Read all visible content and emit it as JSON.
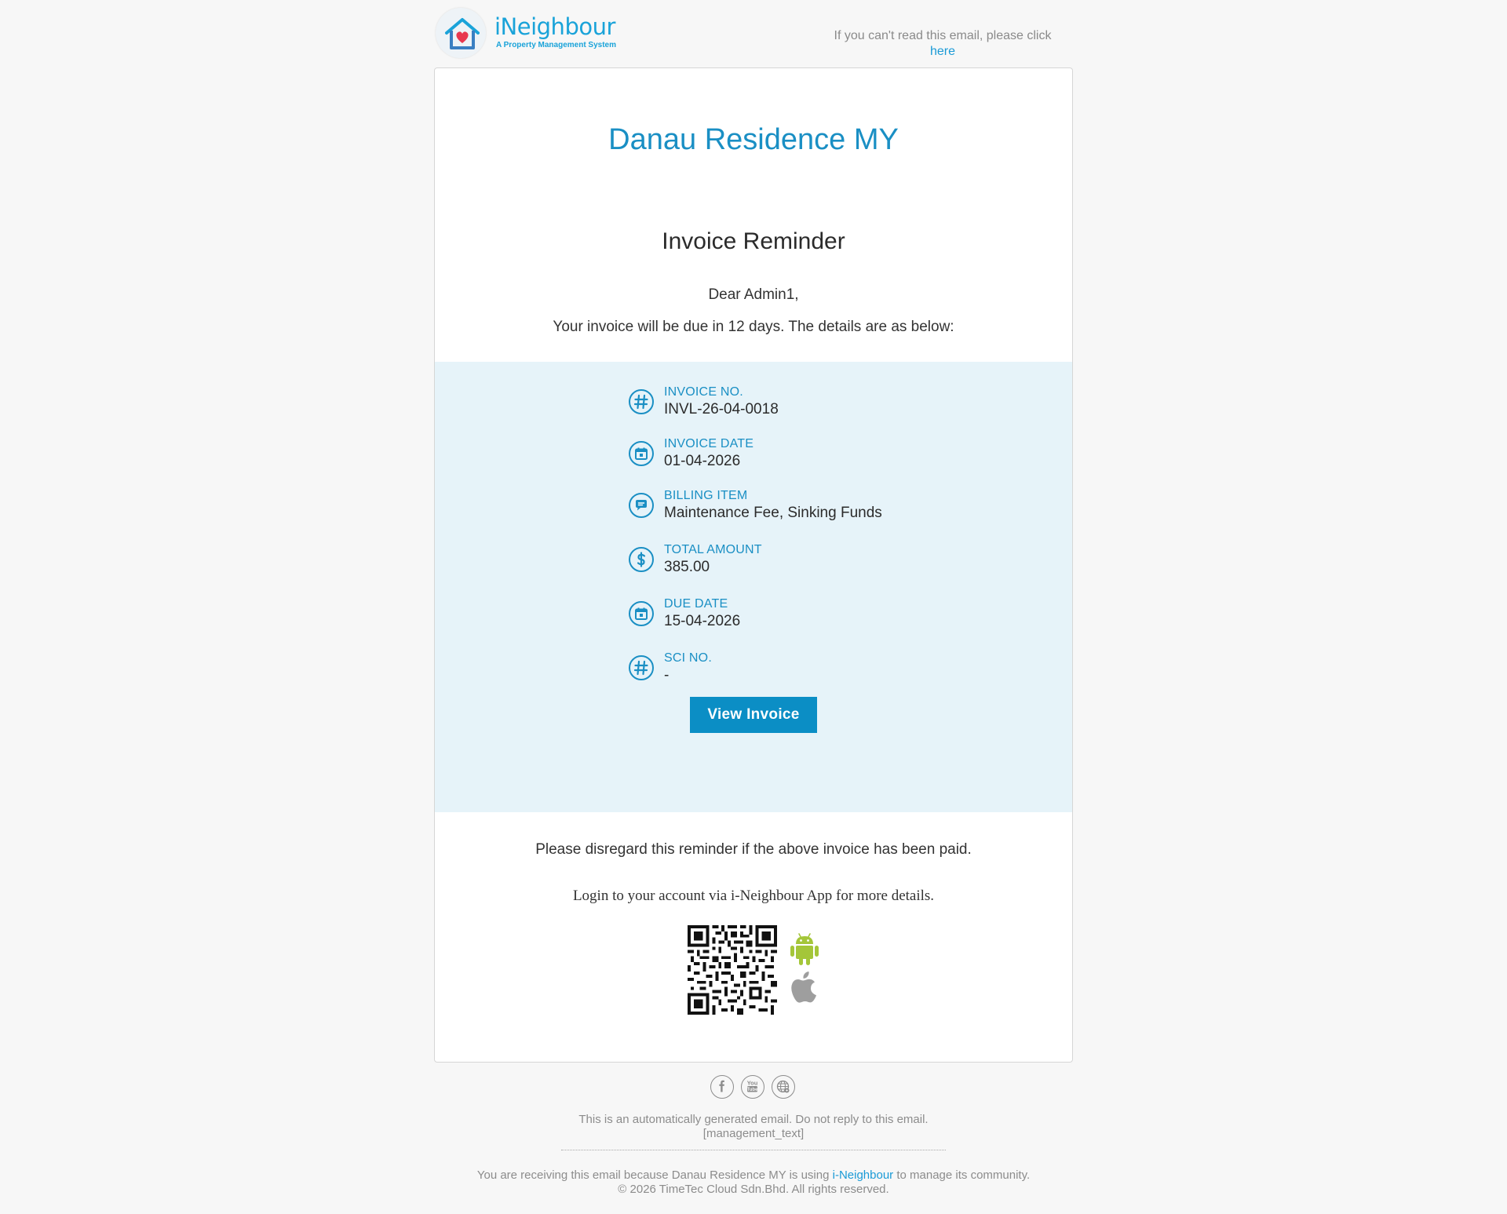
{
  "header": {
    "logo_name": "iNeighbour",
    "logo_tagline": "A Property Management System",
    "cant_read_text": "If you can't read this email, please click",
    "cant_read_link": "here"
  },
  "email": {
    "community_name": "Danau Residence MY",
    "title": "Invoice Reminder",
    "greeting": "Dear Admin1,",
    "intro": "Your invoice will be due in 12 days. The details are as below:",
    "details": [
      {
        "label": "INVOICE NO.",
        "value": "INVL-26-04-0018",
        "icon": "hash-icon"
      },
      {
        "label": "INVOICE DATE",
        "value": "01-04-2026",
        "icon": "calendar-icon"
      },
      {
        "label": "BILLING ITEM",
        "value": "Maintenance Fee, Sinking Funds",
        "icon": "chat-bubble-icon"
      },
      {
        "label": "TOTAL AMOUNT",
        "value": "385.00",
        "icon": "dollar-icon"
      },
      {
        "label": "DUE DATE",
        "value": "15-04-2026",
        "icon": "calendar-icon"
      },
      {
        "label": "SCI NO.",
        "value": "-",
        "icon": "hash-icon"
      }
    ],
    "button_label": "View Invoice",
    "disregard_text": "Please disregard this reminder if the above invoice has been paid.",
    "login_text": "Login to your account via i-Neighbour App for more details."
  },
  "footer": {
    "social_icons": [
      "facebook-icon",
      "youtube-icon",
      "website-icon"
    ],
    "auto_text": "This is an automatically generated email. Do not reply to this email.",
    "management_text": "[management_text]",
    "receiving_prefix": "You are receiving this email because Danau Residence MY is using",
    "receiving_link": "i-Neighbour",
    "receiving_suffix": "to manage its community.",
    "copyright": "© 2026 TimeTec Cloud Sdn.Bhd. All rights reserved."
  },
  "colors": {
    "accent": "#1a8fc4",
    "button": "#0b8ec5",
    "details_bg": "#e6f3f9",
    "page_bg": "#f7f7f7",
    "android_green": "#a4c639",
    "apple_gray": "#9e9e9e"
  }
}
